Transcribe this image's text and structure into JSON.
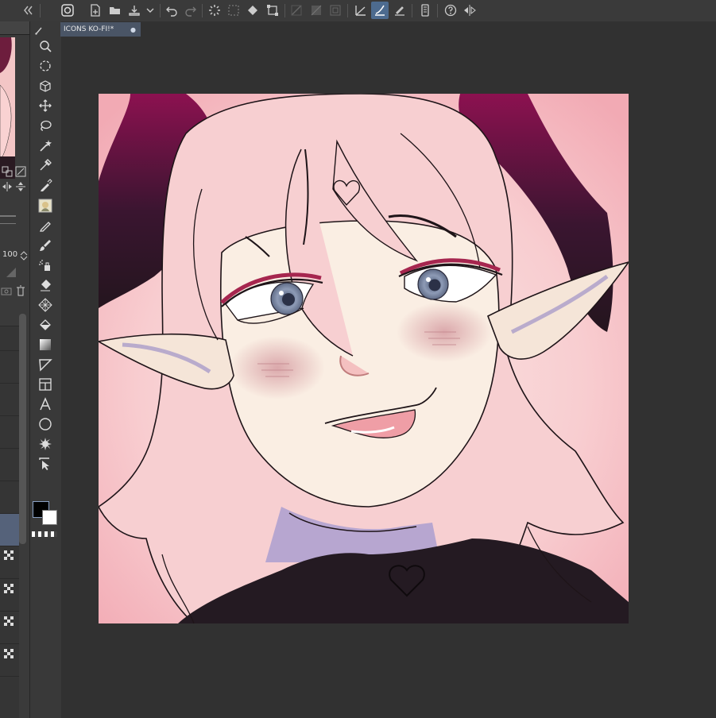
{
  "document": {
    "tab_title": "ICONS KO-FI!*",
    "tab_modified_indicator": "●"
  },
  "left_panel": {
    "opacity_value": "100"
  },
  "toolbar": {
    "icons": [
      "panel-collapse-icon",
      "app-logo-icon",
      "new-file-icon",
      "open-file-icon",
      "save-icon",
      "undo-icon",
      "redo-icon",
      "loading-icon",
      "clear-selection-icon",
      "fill-icon",
      "transform-icon",
      "snap-ruler-icon",
      "snap-grid-icon",
      "special-ruler-icon",
      "ruler-line-icon",
      "stabilizer-icon",
      "pen-pressure-icon",
      "smartphone-icon",
      "help-icon",
      "flip-icon"
    ]
  },
  "tools": [
    "zoom-tool",
    "move-view-tool",
    "object-tool",
    "move-layer-tool",
    "lasso-tool",
    "auto-select-tool",
    "eyedropper-tool",
    "pen-tool",
    "sub-tool-thumb",
    "pencil-tool",
    "brush-tool",
    "airbrush-tool",
    "eraser-tool",
    "blend-tool",
    "fill-tool",
    "gradient-tool",
    "figure-tool",
    "frame-tool",
    "text-tool",
    "balloon-tool",
    "decoration-tool",
    "ruler-tool"
  ],
  "colors": {
    "main": "#000000",
    "sub": "#ffffff",
    "accent": "#4d6b8f",
    "canvas_bg": "#313131"
  }
}
